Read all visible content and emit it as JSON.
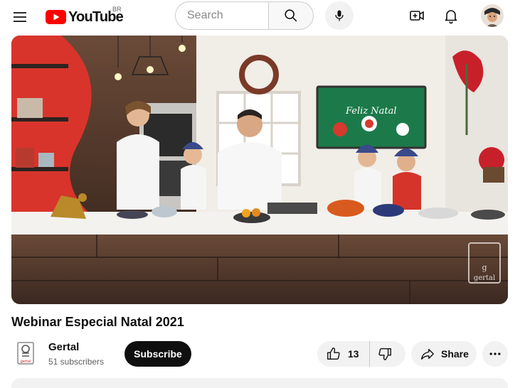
{
  "header": {
    "region_code": "BR",
    "search_placeholder": "Search"
  },
  "video": {
    "title": "Webinar Especial Natal 2021",
    "scene_sign_text": "Feliz Natal",
    "watermark_text": "gertal"
  },
  "channel": {
    "name": "Gertal",
    "subscribers": "51 subscribers",
    "logo_text": "gertal"
  },
  "actions": {
    "subscribe_label": "Subscribe",
    "like_count": "13",
    "share_label": "Share"
  },
  "colors": {
    "brand_red": "#ff0000",
    "subscribe_bg": "#0f0f0f",
    "pill_bg": "#f2f2f2",
    "text_secondary": "#606060"
  }
}
